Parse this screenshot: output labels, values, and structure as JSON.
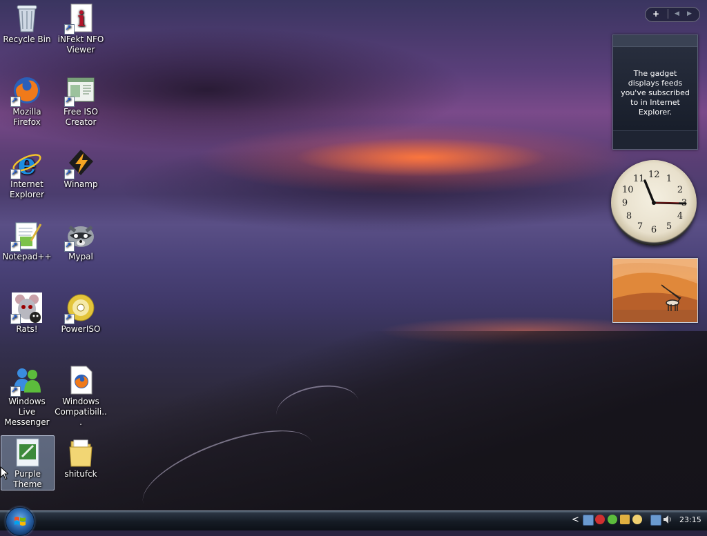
{
  "desktop": {
    "icons": [
      {
        "label": "Recycle Bin"
      },
      {
        "label": "iNFekt NFO Viewer"
      },
      {
        "label": "Mozilla Firefox"
      },
      {
        "label": "Free ISO Creator"
      },
      {
        "label": "Internet Explorer"
      },
      {
        "label": "Winamp"
      },
      {
        "label": "Notepad++"
      },
      {
        "label": "Mypal"
      },
      {
        "label": "Rats!"
      },
      {
        "label": "PowerISO"
      },
      {
        "label": "Windows Live Messenger"
      },
      {
        "label": "Windows Compatibili..."
      },
      {
        "label": "Purple Theme"
      },
      {
        "label": "shitufck"
      }
    ]
  },
  "sidebar": {
    "add_label": "+",
    "prev_label": "◀",
    "next_label": "▶",
    "feed_gadget_text": "The gadget displays feeds you've subscribed to in Internet Explorer.",
    "clock_numbers": [
      "12",
      "1",
      "2",
      "3",
      "4",
      "5",
      "6",
      "7",
      "8",
      "9",
      "10",
      "11"
    ]
  },
  "taskbar": {
    "clock": "23:15",
    "tray_chevron": "<"
  },
  "colors": {
    "accent": "#2f6fb8",
    "taskbar": "#151b24"
  }
}
